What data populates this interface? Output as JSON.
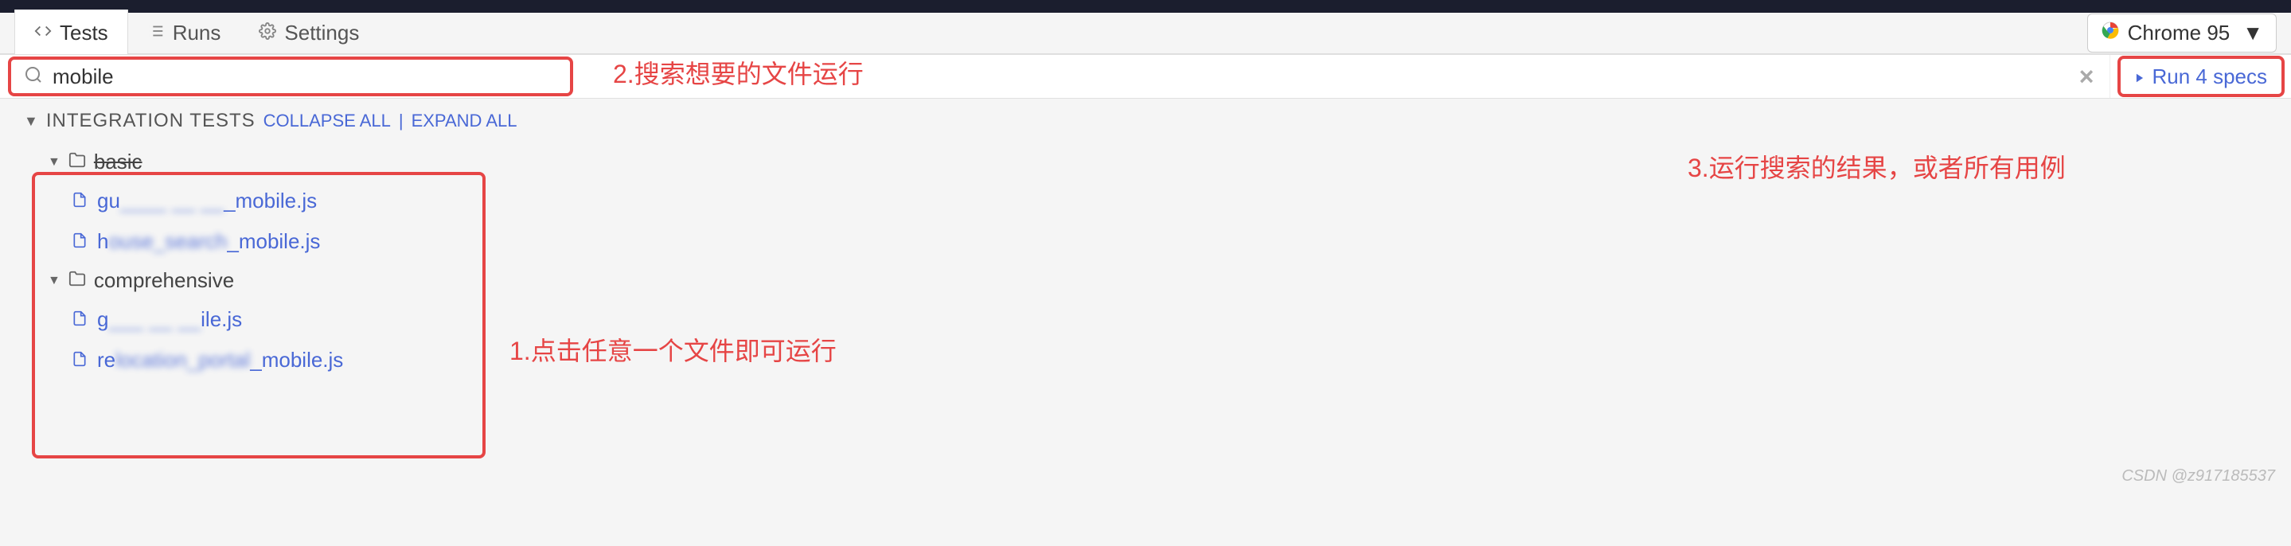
{
  "nav": {
    "tests": "Tests",
    "runs": "Runs",
    "settings": "Settings"
  },
  "browser": {
    "label": "Chrome 95"
  },
  "search": {
    "value": "mobile"
  },
  "run": {
    "label": "Run 4 specs"
  },
  "integration": {
    "title": "INTEGRATION TESTS",
    "collapse": "COLLAPSE ALL",
    "expand": "EXPAND ALL"
  },
  "tree": {
    "folders": [
      {
        "name": "basic",
        "files": [
          {
            "prefix": "gu",
            "obscured": "____ __ __",
            "suffix": "_mobile.js"
          },
          {
            "prefix": "h",
            "obscured": "ouse_search",
            "suffix": "_mobile.js"
          }
        ]
      },
      {
        "name": "comprehensive",
        "files": [
          {
            "prefix": "g",
            "obscured": "___ __ __",
            "suffix": "ile.js"
          },
          {
            "prefix": "re",
            "obscured": "location_portal",
            "suffix": "_mobile.js"
          }
        ]
      }
    ]
  },
  "annotations": {
    "a1": "1.点击任意一个文件即可运行",
    "a2": "2.搜索想要的文件运行",
    "a3": "3.运行搜索的结果，或者所有用例"
  },
  "watermark": "CSDN @z917185537"
}
